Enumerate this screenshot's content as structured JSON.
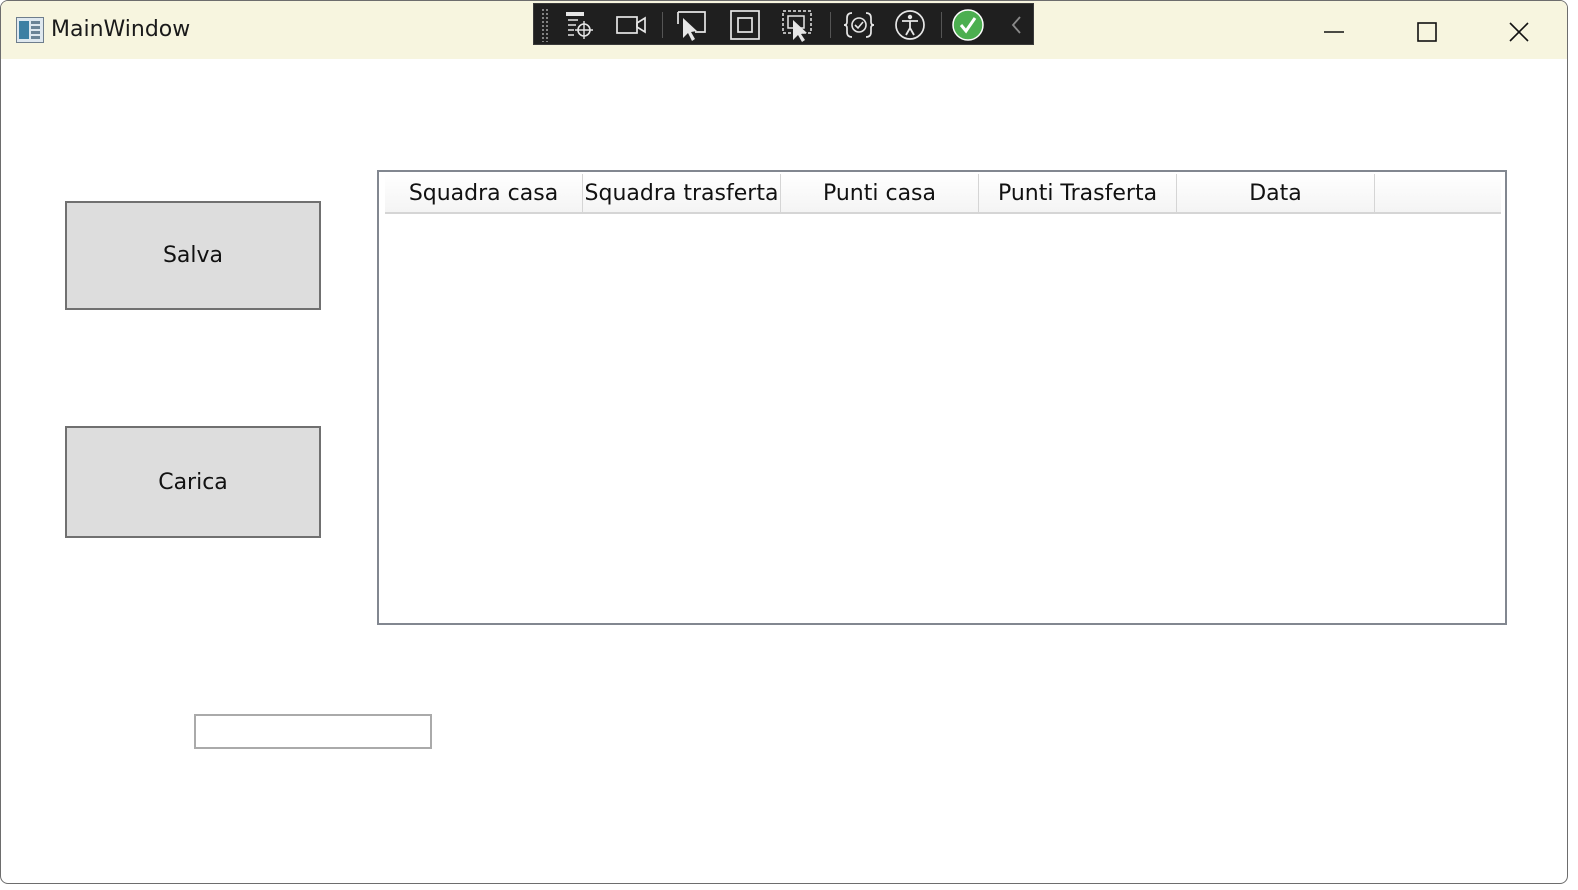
{
  "window": {
    "title": "MainWindow"
  },
  "buttons": {
    "save_label": "Salva",
    "load_label": "Carica"
  },
  "grid": {
    "columns": [
      "Squadra casa",
      "Squadra trasferta",
      "Punti casa",
      "Punti Trasferta",
      "Data"
    ],
    "rows": []
  },
  "input": {
    "value": "",
    "placeholder": ""
  },
  "devtools_toolbar": {
    "icons": [
      "live-visual-tree-icon",
      "record-icon",
      "select-element-icon",
      "display-layout-adorners-icon",
      "track-focus-icon",
      "binding-failures-icon",
      "accessibility-checker-icon",
      "hot-reload-status-icon",
      "collapse-icon"
    ]
  },
  "colors": {
    "titlebar": "#f7f5df",
    "button_face": "#dddddd",
    "hot_reload_ok": "#4caf50"
  }
}
